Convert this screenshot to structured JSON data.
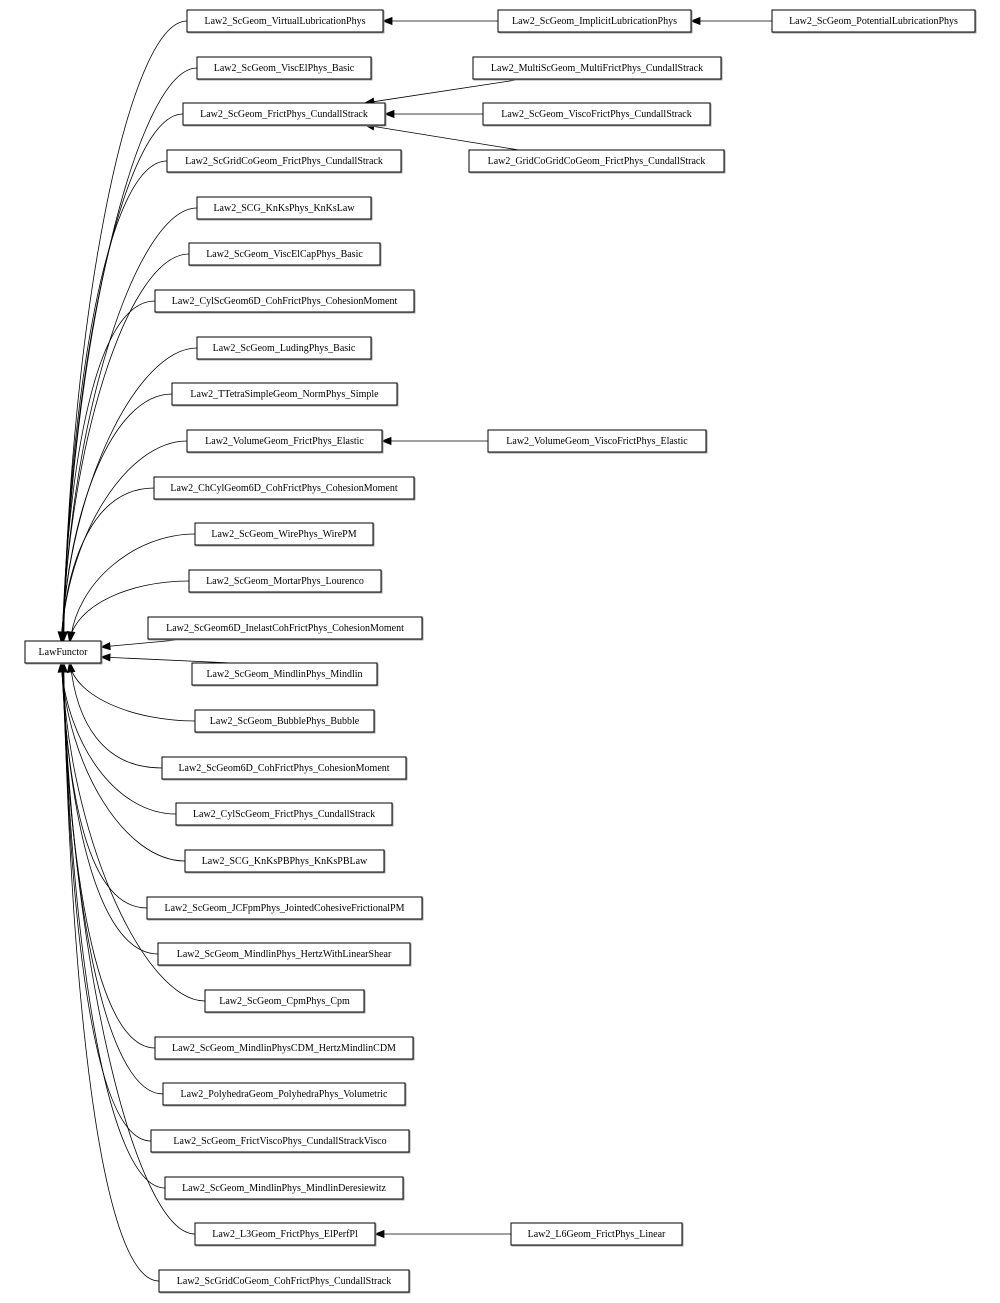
{
  "diagram": {
    "type": "inheritance-graph",
    "direction": "right-to-left",
    "colors": {
      "node_border": "#000000",
      "node_fill": "#ffffff",
      "edge": "#000000",
      "text": "#000000"
    },
    "root": {
      "id": "LawFunctor",
      "label": "LawFunctor"
    },
    "nodes": [
      {
        "id": "n1",
        "label": "Law2_ScGeom_VirtualLubricationPhys",
        "parent": "LawFunctor"
      },
      {
        "id": "n2",
        "label": "Law2_ScGeom_ViscElPhys_Basic",
        "parent": "LawFunctor"
      },
      {
        "id": "n3",
        "label": "Law2_ScGeom_FrictPhys_CundallStrack",
        "parent": "LawFunctor"
      },
      {
        "id": "n4",
        "label": "Law2_ScGridCoGeom_FrictPhys_CundallStrack",
        "parent": "LawFunctor"
      },
      {
        "id": "n5",
        "label": "Law2_SCG_KnKsPhys_KnKsLaw",
        "parent": "LawFunctor"
      },
      {
        "id": "n6",
        "label": "Law2_ScGeom_ViscElCapPhys_Basic",
        "parent": "LawFunctor"
      },
      {
        "id": "n7",
        "label": "Law2_CylScGeom6D_CohFrictPhys_CohesionMoment",
        "parent": "LawFunctor"
      },
      {
        "id": "n8",
        "label": "Law2_ScGeom_LudingPhys_Basic",
        "parent": "LawFunctor"
      },
      {
        "id": "n9",
        "label": "Law2_TTetraSimpleGeom_NormPhys_Simple",
        "parent": "LawFunctor"
      },
      {
        "id": "n10",
        "label": "Law2_VolumeGeom_FrictPhys_Elastic",
        "parent": "LawFunctor"
      },
      {
        "id": "n11",
        "label": "Law2_ChCylGeom6D_CohFrictPhys_CohesionMoment",
        "parent": "LawFunctor"
      },
      {
        "id": "n12",
        "label": "Law2_ScGeom_WirePhys_WirePM",
        "parent": "LawFunctor"
      },
      {
        "id": "n13",
        "label": "Law2_ScGeom_MortarPhys_Lourenco",
        "parent": "LawFunctor"
      },
      {
        "id": "n14",
        "label": "Law2_ScGeom6D_InelastCohFrictPhys_CohesionMoment",
        "parent": "LawFunctor"
      },
      {
        "id": "n15",
        "label": "Law2_ScGeom_MindlinPhys_Mindlin",
        "parent": "LawFunctor"
      },
      {
        "id": "n16",
        "label": "Law2_ScGeom_BubblePhys_Bubble",
        "parent": "LawFunctor"
      },
      {
        "id": "n17",
        "label": "Law2_ScGeom6D_CohFrictPhys_CohesionMoment",
        "parent": "LawFunctor"
      },
      {
        "id": "n18",
        "label": "Law2_CylScGeom_FrictPhys_CundallStrack",
        "parent": "LawFunctor"
      },
      {
        "id": "n19",
        "label": "Law2_SCG_KnKsPBPhys_KnKsPBLaw",
        "parent": "LawFunctor"
      },
      {
        "id": "n20",
        "label": "Law2_ScGeom_JCFpmPhys_JointedCohesiveFrictionalPM",
        "parent": "LawFunctor"
      },
      {
        "id": "n21",
        "label": "Law2_ScGeom_MindlinPhys_HertzWithLinearShear",
        "parent": "LawFunctor"
      },
      {
        "id": "n22",
        "label": "Law2_ScGeom_CpmPhys_Cpm",
        "parent": "LawFunctor"
      },
      {
        "id": "n23",
        "label": "Law2_ScGeom_MindlinPhysCDM_HertzMindlinCDM",
        "parent": "LawFunctor"
      },
      {
        "id": "n24",
        "label": "Law2_PolyhedraGeom_PolyhedraPhys_Volumetric",
        "parent": "LawFunctor"
      },
      {
        "id": "n25",
        "label": "Law2_ScGeom_FrictViscoPhys_CundallStrackVisco",
        "parent": "LawFunctor"
      },
      {
        "id": "n26",
        "label": "Law2_ScGeom_MindlinPhys_MindlinDeresiewitz",
        "parent": "LawFunctor"
      },
      {
        "id": "n27",
        "label": "Law2_L3Geom_FrictPhys_ElPerfPl",
        "parent": "LawFunctor"
      },
      {
        "id": "n28",
        "label": "Law2_ScGridCoGeom_CohFrictPhys_CundallStrack",
        "parent": "LawFunctor"
      },
      {
        "id": "m1",
        "label": "Law2_ScGeom_ImplicitLubricationPhys",
        "parent": "n1"
      },
      {
        "id": "m2",
        "label": "Law2_ScGeom_PotentialLubricationPhys",
        "parent": "m1"
      },
      {
        "id": "m3",
        "label": "Law2_MultiScGeom_MultiFrictPhys_CundallStrack",
        "parent": "n3"
      },
      {
        "id": "m4",
        "label": "Law2_ScGeom_ViscoFrictPhys_CundallStrack",
        "parent": "n3"
      },
      {
        "id": "m5",
        "label": "Law2_GridCoGridCoGeom_FrictPhys_CundallStrack",
        "parent": "n3"
      },
      {
        "id": "m6",
        "label": "Law2_VolumeGeom_ViscoFrictPhys_Elastic",
        "parent": "n10"
      },
      {
        "id": "m7",
        "label": "Law2_L6Geom_FrictPhys_Linear",
        "parent": "n27"
      }
    ]
  }
}
